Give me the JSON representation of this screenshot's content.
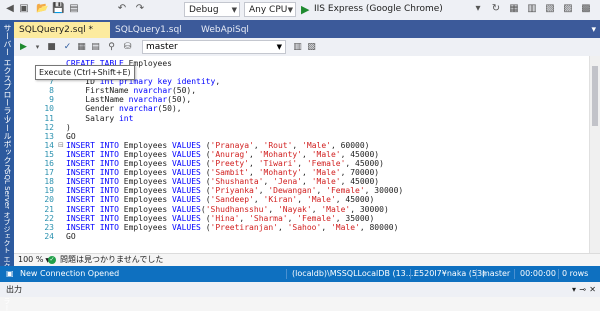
{
  "toolbar": {
    "config": "Debug",
    "platform": "Any CPU",
    "run_target": "IIS Express (Google Chrome)"
  },
  "side_rail": {
    "items": [
      "サーバー エクスプローラー",
      "ツールボックス",
      "SQL Server オブジェクト エクスプローラー"
    ]
  },
  "tabs": [
    {
      "label": "SQLQuery2.sql *",
      "active": true
    },
    {
      "label": "SQLQuery1.sql",
      "active": false
    },
    {
      "label": "WebApiSql",
      "active": false
    }
  ],
  "query_toolbar": {
    "database": "master"
  },
  "tooltip": "Execute (Ctrl+Shift+E)",
  "editor": {
    "lines": [
      {
        "n": "",
        "html": "<span class=\"kw\">CREATE TABLE</span> Employees",
        "fold": ""
      },
      {
        "n": "",
        "html": "(",
        "fold": ""
      },
      {
        "n": "7",
        "html": "    ID <span class=\"kw\">int primary key identity</span>,",
        "fold": ""
      },
      {
        "n": "8",
        "html": "    FirstName <span class=\"kw\">nvarchar</span>(50),",
        "fold": ""
      },
      {
        "n": "9",
        "html": "    LastName <span class=\"kw\">nvarchar</span>(50),",
        "fold": ""
      },
      {
        "n": "10",
        "html": "    Gender <span class=\"kw\">nvarchar</span>(50),",
        "fold": ""
      },
      {
        "n": "11",
        "html": "    Salary <span class=\"kw\">int</span>",
        "fold": ""
      },
      {
        "n": "12",
        "html": ")",
        "fold": ""
      },
      {
        "n": "13",
        "html": "GO",
        "fold": ""
      },
      {
        "n": "14",
        "html": "<span class=\"kw\">INSERT INTO</span> Employees <span class=\"kw\">VALUES</span> (<span class=\"str\">'Pranaya'</span>, <span class=\"str\">'Rout'</span>, <span class=\"str\">'Male'</span>, 60000)",
        "fold": "⊟"
      },
      {
        "n": "15",
        "html": "<span class=\"kw\">INSERT INTO</span> Employees <span class=\"kw\">VALUES</span> (<span class=\"str\">'Anurag'</span>, <span class=\"str\">'Mohanty'</span>, <span class=\"str\">'Male'</span>, 45000)",
        "fold": ""
      },
      {
        "n": "16",
        "html": "<span class=\"kw\">INSERT INTO</span> Employees <span class=\"kw\">VALUES</span> (<span class=\"str\">'Preety'</span>, <span class=\"str\">'Tiwari'</span>, <span class=\"str\">'Female'</span>, 45000)",
        "fold": ""
      },
      {
        "n": "17",
        "html": "<span class=\"kw\">INSERT INTO</span> Employees <span class=\"kw\">VALUES</span> (<span class=\"str\">'Sambit'</span>, <span class=\"str\">'Mohanty'</span>, <span class=\"str\">'Male'</span>, 70000)",
        "fold": ""
      },
      {
        "n": "18",
        "html": "<span class=\"kw\">INSERT INTO</span> Employees <span class=\"kw\">VALUES</span> (<span class=\"str\">'Shushanta'</span>, <span class=\"str\">'Jena'</span>, <span class=\"str\">'Male'</span>, 45000)",
        "fold": ""
      },
      {
        "n": "19",
        "html": "<span class=\"kw\">INSERT INTO</span> Employees <span class=\"kw\">VALUES</span> (<span class=\"str\">'Priyanka'</span>, <span class=\"str\">'Dewangan'</span>, <span class=\"str\">'Female'</span>, 30000)",
        "fold": ""
      },
      {
        "n": "20",
        "html": "<span class=\"kw\">INSERT INTO</span> Employees <span class=\"kw\">VALUES</span> (<span class=\"str\">'Sandeep'</span>, <span class=\"str\">'Kiran'</span>, <span class=\"str\">'Male'</span>, 45000)",
        "fold": ""
      },
      {
        "n": "21",
        "html": "<span class=\"kw\">INSERT INTO</span> Employees <span class=\"kw\">VALUES</span>(<span class=\"str\">'Shudhansshu'</span>, <span class=\"str\">'Nayak'</span>, <span class=\"str\">'Male'</span>, 30000)",
        "fold": ""
      },
      {
        "n": "22",
        "html": "<span class=\"kw\">INSERT INTO</span> Employees <span class=\"kw\">VALUES</span> (<span class=\"str\">'Hina'</span>, <span class=\"str\">'Sharma'</span>, <span class=\"str\">'Female'</span>, 35000)",
        "fold": ""
      },
      {
        "n": "23",
        "html": "<span class=\"kw\">INSERT INTO</span> Employees <span class=\"kw\">VALUES</span> (<span class=\"str\">'Preetiranjan'</span>, <span class=\"str\">'Sahoo'</span>, <span class=\"str\">'Male'</span>, 80000)",
        "fold": ""
      },
      {
        "n": "24",
        "html": "GO",
        "fold": ""
      }
    ]
  },
  "editor_status": {
    "zoom": "100 %",
    "issues": "問題は見つかりませんでした"
  },
  "status_bar": {
    "connection": "New Connection Opened",
    "server": "(localdb)\\MSSQLLocalDB (13....",
    "user": "E520I7¥naka (53)",
    "database": "master",
    "time": "00:00:00",
    "rows": "0 rows"
  },
  "output": {
    "title": "出力"
  },
  "colors": {
    "tab_strip": "#3c5a9a",
    "active_tab": "#fceb9f",
    "status_bar": "#0e70c0",
    "keyword": "#0000ff",
    "string": "#d11f1f",
    "line_number": "#2b91af"
  }
}
